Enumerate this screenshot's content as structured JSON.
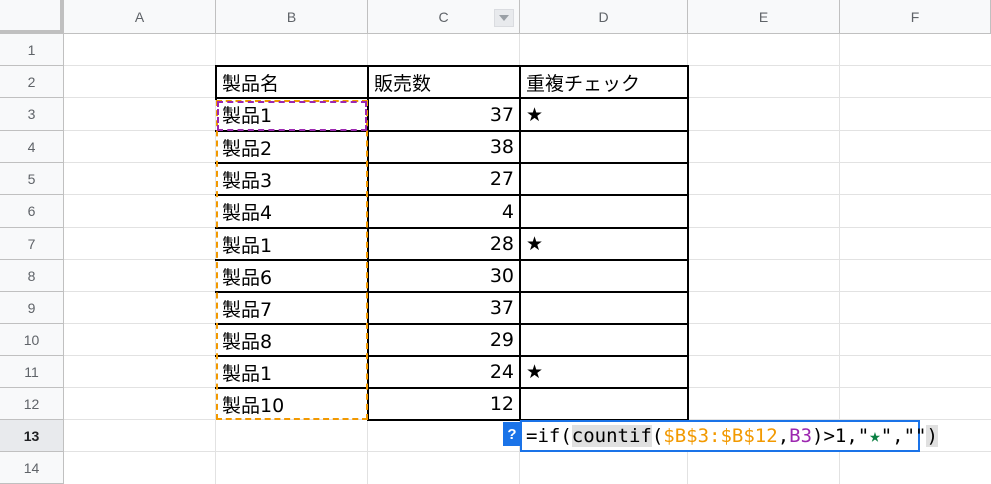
{
  "columns": [
    "A",
    "B",
    "C",
    "D",
    "E",
    "F"
  ],
  "rows": [
    "1",
    "2",
    "3",
    "4",
    "5",
    "6",
    "7",
    "8",
    "9",
    "10",
    "11",
    "12",
    "13",
    "14"
  ],
  "table": {
    "headers": [
      "製品名",
      "販売数",
      "重複チェック"
    ],
    "rows": [
      {
        "name": "製品1",
        "sales": "37",
        "check": "★"
      },
      {
        "name": "製品2",
        "sales": "38",
        "check": ""
      },
      {
        "name": "製品3",
        "sales": "27",
        "check": ""
      },
      {
        "name": "製品4",
        "sales": "4",
        "check": ""
      },
      {
        "name": "製品1",
        "sales": "28",
        "check": "★"
      },
      {
        "name": "製品6",
        "sales": "30",
        "check": ""
      },
      {
        "name": "製品7",
        "sales": "37",
        "check": ""
      },
      {
        "name": "製品8",
        "sales": "29",
        "check": ""
      },
      {
        "name": "製品1",
        "sales": "24",
        "check": "★"
      },
      {
        "name": "製品10",
        "sales": "12",
        "check": ""
      }
    ]
  },
  "formula_editor": {
    "help_label": "?",
    "parts": {
      "p1": "=if(",
      "p2": "countif",
      "p3": "(",
      "p4": "$B$3:$B$12",
      "p5": ",",
      "p6": "B3",
      "p7": ")>1,\"",
      "p8": "★",
      "p9": "\",\"\"",
      "p10": ")"
    }
  },
  "colors": {
    "range_primary": "#f29900",
    "range_secondary": "#9c27b0",
    "editor_border": "#1a73e8",
    "star_in_formula": "#0b8043"
  }
}
